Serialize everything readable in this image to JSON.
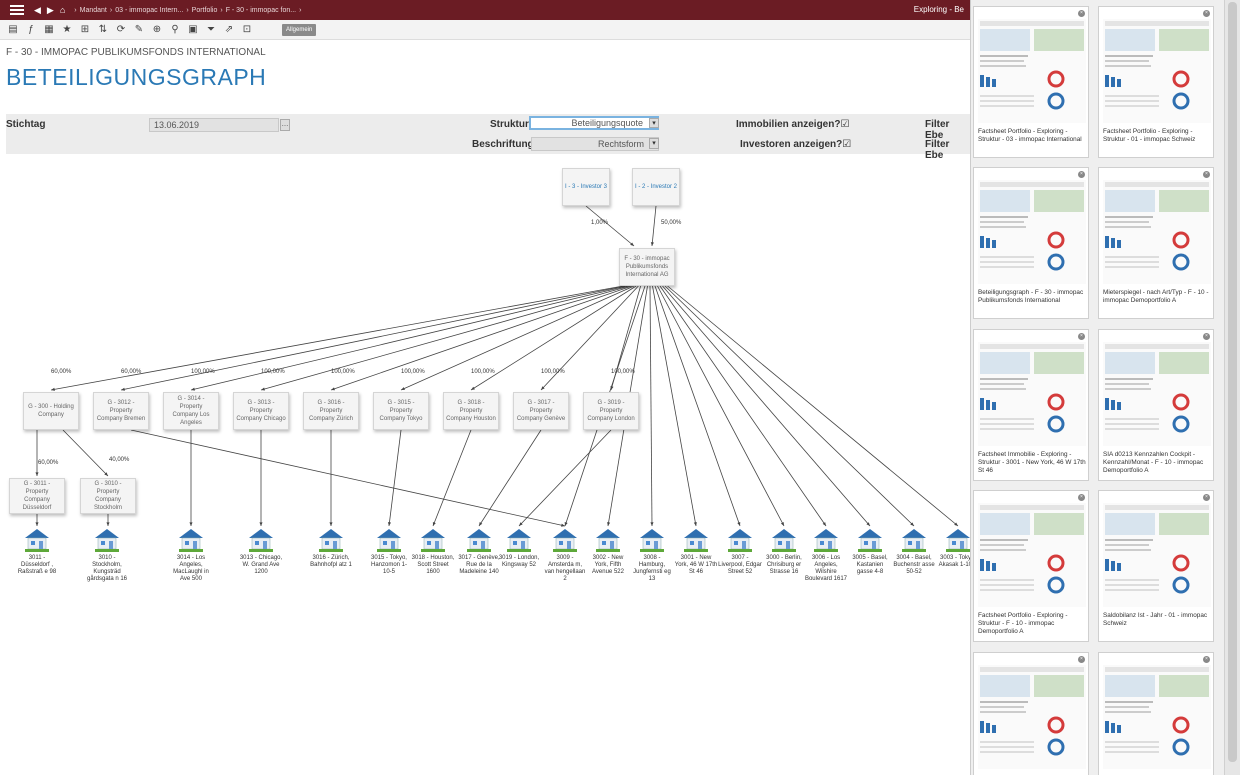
{
  "topbar": {
    "breadcrumbs": [
      "Mandant",
      "03 - immopac Intern...",
      "Portfolio",
      "F - 30 - immopac fon..."
    ],
    "right_text": "Exploring - Be"
  },
  "toolbar": {
    "allgemein_label": "Allgemein"
  },
  "header": {
    "subtitle": "F - 30 - IMMOPAC PUBLIKUMSFONDS INTERNATIONAL",
    "title": "BETEILIGUNGSGRAPH"
  },
  "filters": {
    "stichtag_label": "Stichtag",
    "stichtag_value": "13.06.2019",
    "struktur_label": "Struktur",
    "struktur_value": "Beteiligungsquote",
    "beschriftung_label": "Beschriftung",
    "beschriftung_value": "Rechtsform",
    "immobilien_label": "Immobilien anzeigen?☑",
    "investoren_label": "Investoren anzeigen?☑",
    "filter_ebene_label1": "Filter Ebe",
    "filter_ebene_label2": "Filter Ebe"
  },
  "graph": {
    "investors": [
      {
        "label": "I - 3 - Investor 3",
        "edge": "1,00%"
      },
      {
        "label": "I - 2 - Investor 2",
        "edge": "50,00%"
      }
    ],
    "fund": "F - 30 - immopac Publikumsfonds International AG",
    "companies": [
      {
        "label": "G - 300 - Holding Company",
        "edge": "60,00%"
      },
      {
        "label": "G - 3012 - Property Company Bremen",
        "edge": "60,00%"
      },
      {
        "label": "G - 3014 - Property Company Los Angeles",
        "edge": "100,00%"
      },
      {
        "label": "G - 3013 - Property Company Chicago",
        "edge": "100,00%"
      },
      {
        "label": "G - 3016 - Property Company Zürich",
        "edge": "100,00%"
      },
      {
        "label": "G - 3015 - Property Company Tokyo",
        "edge": "100,00%"
      },
      {
        "label": "G - 3018 - Property Company Houston",
        "edge": "100,00%"
      },
      {
        "label": "G - 3017 - Property Company Genève",
        "edge": "100,00%"
      },
      {
        "label": "G - 3019 - Property Company London",
        "edge": "100,00%"
      }
    ],
    "subcompanies": [
      {
        "label": "G - 3011 - Property Company Düsseldorf",
        "edge": "60,00%"
      },
      {
        "label": "G - 3010 - Property Company Stockholm",
        "edge": "40,00%"
      }
    ],
    "properties": [
      "3011 - Düsseldorf , Raßstraß e 98",
      "3010 - Stockholm, Kungsträd gårdsgata n 16",
      "3014 - Los Angeles, MacLaughl in Ave 500",
      "3013 - Chicago, W. Grand Ave 1200",
      "3016 - Zürich, Bahnhofpl atz 1",
      "3015 - Tokyo, Hanzomon 1-10-5",
      "3018 - Houston, Scott Street 1600",
      "3017 - Genève, Rue de la Madeleine 140",
      "3019 - London, Kingsway 52",
      "3009 - Amsterda m, van hengellaan 2",
      "3002 - New York, Fifth Avenue 522",
      "3008 - Hamburg, Jungfernsti eg 13",
      "3001 - New York, 46 W 17th St 46",
      "3007 - Liverpool, Edgar Street 52",
      "3000 - Berlin, Chrisiburg er Strasse 16",
      "3006 - Los Angeles, Wilshire Boulevard 1617",
      "3005 - Basel, Kastanien gasse 4-8",
      "3004 - Basel, Buchenstr asse 50-52",
      "3003 - Tokyo, Akasak 1-10-1"
    ]
  },
  "panel": {
    "cards": [
      {
        "title": "Factsheet Portfolio - Exploring - Struktur - 03 - immopac International"
      },
      {
        "title": "Factsheet Portfolio - Exploring - Struktur - 01 - immopac Schweiz"
      },
      {
        "title": "Beteiligungsgraph - F - 30 - immopac Publikumsfonds International"
      },
      {
        "title": "Mieterspiegel - nach Art/Typ - F - 10 - immopac Demoportfolio A"
      },
      {
        "title": "Factsheet Immobilie - Exploring - Struktur - 3001 - New York, 46 W 17th St 46"
      },
      {
        "title": "SIA d0213 Kennzahlen Cockpit - Kennzahl/Monat - F - 10 - immopac Demoportfolio A"
      },
      {
        "title": "Factsheet Portfolio - Exploring - Struktur - F - 10 - immopac Demoportfolio A"
      },
      {
        "title": "Saldobilanz Ist - Jahr - 01 - immopac Schweiz"
      },
      {
        "title": ""
      },
      {
        "title": ""
      }
    ]
  }
}
